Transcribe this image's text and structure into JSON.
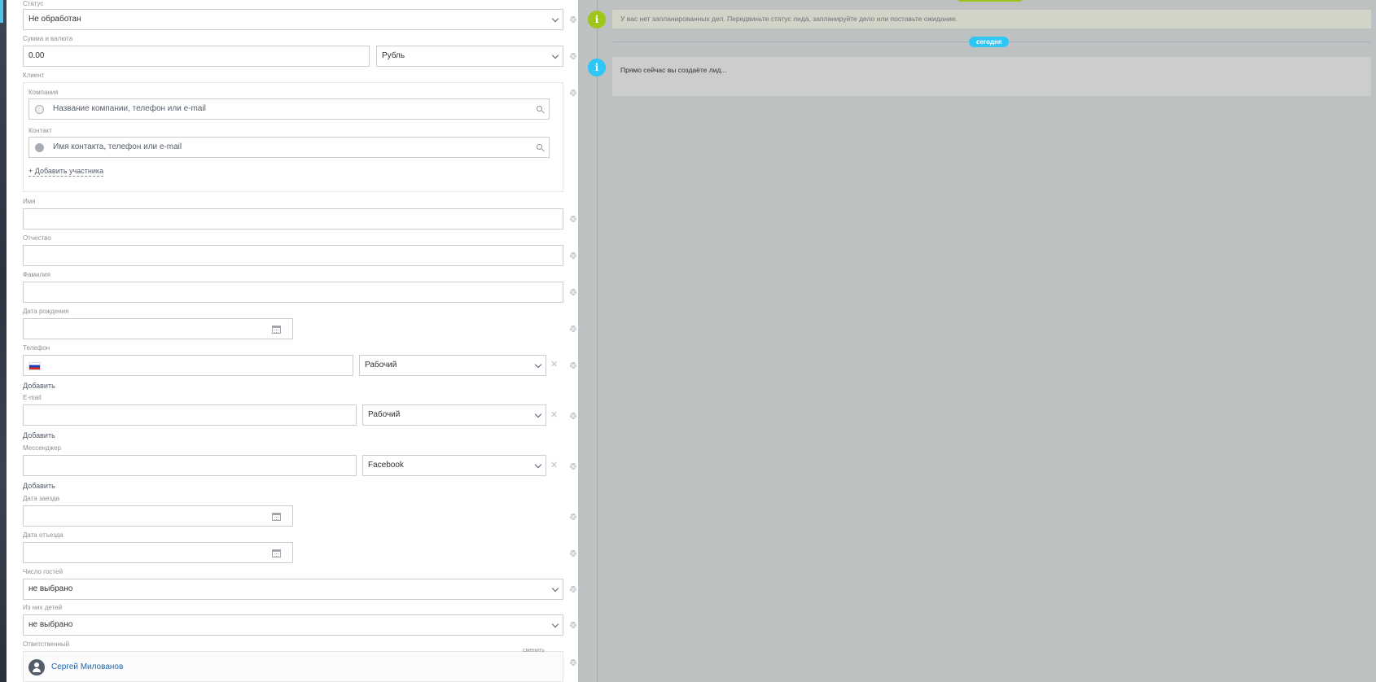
{
  "form": {
    "status": {
      "label": "Статус",
      "value": "Не обработан"
    },
    "amount": {
      "label": "Сумма и валюта",
      "value": "0.00",
      "currency": "Рубль"
    },
    "client": {
      "label": "Клиент",
      "company_label": "Компания",
      "company_placeholder": "Название компании, телефон или e-mail",
      "contact_label": "Контакт",
      "contact_placeholder": "Имя контакта, телефон или e-mail",
      "add_participant": "+ Добавить участника"
    },
    "first_name": {
      "label": "Имя",
      "value": ""
    },
    "middle_name": {
      "label": "Отчество",
      "value": ""
    },
    "last_name": {
      "label": "Фамилия",
      "value": ""
    },
    "birth_date": {
      "label": "Дата рождения",
      "value": ""
    },
    "phone": {
      "label": "Телефон",
      "value": "",
      "type": "Рабочий",
      "add": "Добавить"
    },
    "email": {
      "label": "E-mail",
      "value": "",
      "type": "Рабочий",
      "add": "Добавить"
    },
    "messenger": {
      "label": "Мессенджер",
      "value": "",
      "type": "Facebook",
      "add": "Добавить"
    },
    "arrival_date": {
      "label": "Дата заезда",
      "value": ""
    },
    "departure_date": {
      "label": "Дата отъезда",
      "value": ""
    },
    "guests": {
      "label": "Число гостей",
      "value": "не выбрано"
    },
    "children": {
      "label": "Из них детей",
      "value": "не выбрано"
    },
    "responsible": {
      "label": "Ответственный",
      "change": "сменить",
      "name": "Сергей Милованов"
    }
  },
  "timeline": {
    "notice": "У вас нет запланированных дел. Передвиньте статус лида, запланируйте дело или поставьте ожидание.",
    "today_badge": "сегодня",
    "event_text": "Прямо сейчас вы создаёте лид..."
  },
  "colors": {
    "accent_green": "#9dc51b",
    "accent_blue": "#2fc6f6",
    "timeline_bg": "#bdc1c2",
    "link_blue": "#2067b0"
  }
}
